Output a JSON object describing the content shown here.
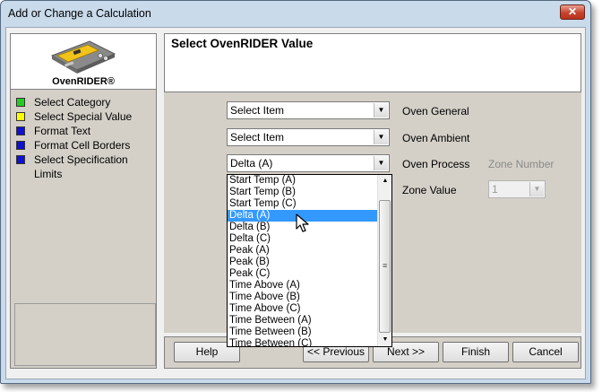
{
  "window": {
    "title": "Add or Change a Calculation",
    "close_label": "✕"
  },
  "logo": {
    "label": "OvenRIDER®"
  },
  "steps": [
    {
      "label": "Select Category",
      "color": "#22cc22"
    },
    {
      "label": "Select Special Value",
      "color": "#ffff00"
    },
    {
      "label": "Format Text",
      "color": "#1010d0"
    },
    {
      "label": "Format Cell Borders",
      "color": "#1010d0"
    },
    {
      "label": "Select Specification Limits",
      "color": "#1010d0"
    }
  ],
  "page_title": "Select OvenRIDER Value",
  "form": {
    "oven_general": {
      "value": "Select Item",
      "label": "Oven General"
    },
    "oven_ambient": {
      "value": "Select Item",
      "label": "Oven Ambient"
    },
    "oven_process": {
      "value": "Delta (A)",
      "label": "Oven Process"
    },
    "zone_number": {
      "label": "Zone Number"
    },
    "zone_value": {
      "label": "Zone Value",
      "value": "1"
    }
  },
  "dropdown": {
    "options": [
      "Start Temp (A)",
      "Start Temp (B)",
      "Start Temp (C)",
      "Delta (A)",
      "Delta (B)",
      "Delta (C)",
      "Peak (A)",
      "Peak (B)",
      "Peak (C)",
      "Time Above (A)",
      "Time Above (B)",
      "Time Above (C)",
      "Time Between (A)",
      "Time Between (B)",
      "Time Between (C)"
    ],
    "selected": "Delta (A)",
    "highlight_color": "#3399ff"
  },
  "buttons": {
    "help": "Help",
    "previous": "<< Previous",
    "next": "Next >>",
    "finish": "Finish",
    "cancel": "Cancel"
  },
  "icons": {
    "close": "close-icon",
    "dropdown_arrow": "chevron-down-icon",
    "cursor": "mouse-pointer-icon"
  }
}
